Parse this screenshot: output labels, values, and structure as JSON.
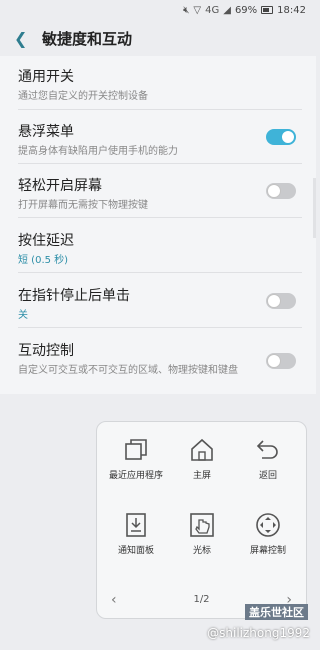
{
  "status": {
    "battery": "69%",
    "time": "18:42",
    "network": "4G"
  },
  "header": {
    "back_icon": "chevron-left-icon",
    "title": "敏捷度和互动"
  },
  "settings": [
    {
      "title": "通用开关",
      "subtitle": "通过您自定义的开关控制设备"
    },
    {
      "title": "悬浮菜单",
      "subtitle": "提高身体有缺陷用户使用手机的能力",
      "toggle": "on"
    },
    {
      "title": "轻松开启屏幕",
      "subtitle": "打开屏幕而无需按下物理按键",
      "toggle": "off"
    },
    {
      "title": "按住延迟",
      "subtitle": "短 (0.5 秒)"
    },
    {
      "title": "在指针停止后单击",
      "subtitle": "关",
      "toggle": "off"
    },
    {
      "title": "互动控制",
      "subtitle": "自定义可交互或不可交互的区域、物理按键和键盘",
      "toggle": "off"
    }
  ],
  "floating_menu": {
    "items": [
      {
        "label": "最近应用程序",
        "icon": "recent-apps-icon"
      },
      {
        "label": "主屏",
        "icon": "home-icon"
      },
      {
        "label": "返回",
        "icon": "back-arrow-icon"
      },
      {
        "label": "通知面板",
        "icon": "notification-panel-icon"
      },
      {
        "label": "光标",
        "icon": "cursor-icon"
      },
      {
        "label": "屏幕控制",
        "icon": "screen-control-icon"
      }
    ],
    "page": "1/2"
  },
  "watermark": {
    "brand": "盖乐世社区",
    "user": "@shilizhong1992"
  },
  "colors": {
    "accent": "#3fb3d8",
    "link": "#2e8fa8"
  }
}
